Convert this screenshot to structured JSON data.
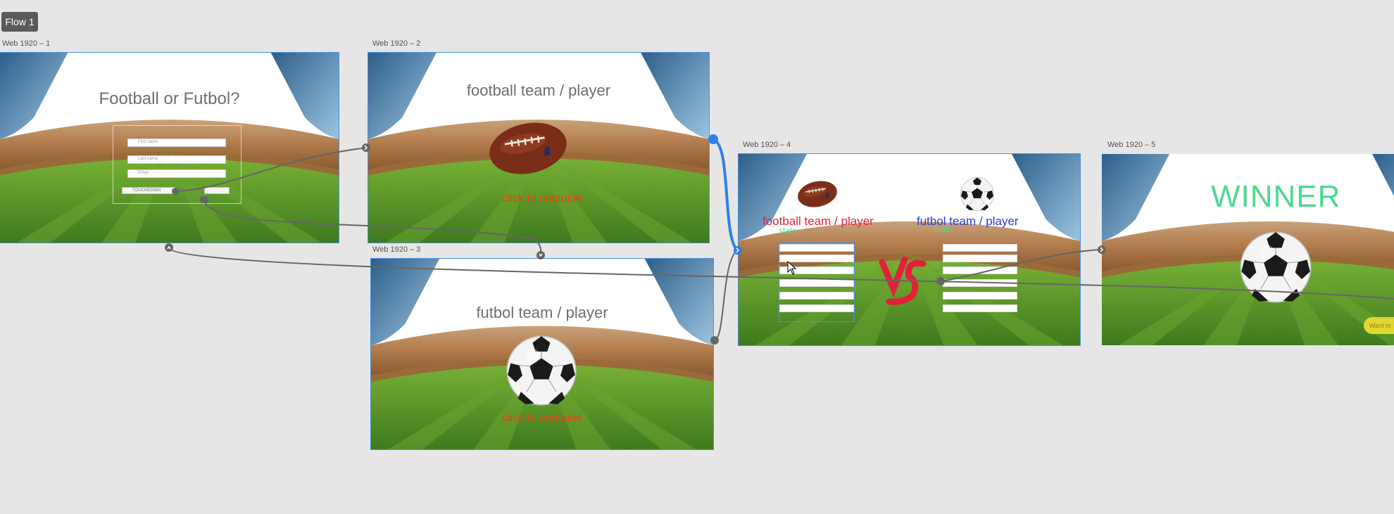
{
  "flow": {
    "label": "Flow 1"
  },
  "artboards": {
    "a1": {
      "label": "Web 1920 – 1",
      "title": "Football or Futbol?",
      "form": {
        "first_name": "First name",
        "last_name": "Last name",
        "email": "Email",
        "button": "TOUCHDOWN"
      }
    },
    "a2": {
      "label": "Web 1920 – 2",
      "title": "football team / player",
      "continue": "click to contuine"
    },
    "a3": {
      "label": "Web 1920 – 3",
      "title": "futbol team / player",
      "continue": "click to contuine"
    },
    "a4": {
      "label": "Web 1920 – 4",
      "left_team": "football team / player",
      "right_team": "futbol team / player",
      "stats_left": "stats",
      "stats_right": "stats"
    },
    "a5": {
      "label": "Web 1920 – 5",
      "winner": "WINNER",
      "want_chip": "Want to"
    }
  },
  "colors": {
    "canvas_bg": "#e6e6e6",
    "selection_blue": "#4a90e2",
    "wire_gray": "#666666",
    "active_wire_blue": "#2f7fe8",
    "left_team_red": "#e3203a",
    "right_team_blue": "#2a3bd6",
    "stats_green": "#4cd98a",
    "winner_green": "#4fd88f",
    "continue_orange": "#e8430f"
  },
  "icons": [
    "american-football-icon",
    "soccer-ball-icon",
    "vs-icon",
    "cursor-arrow-icon",
    "connector-arrow-icon"
  ]
}
